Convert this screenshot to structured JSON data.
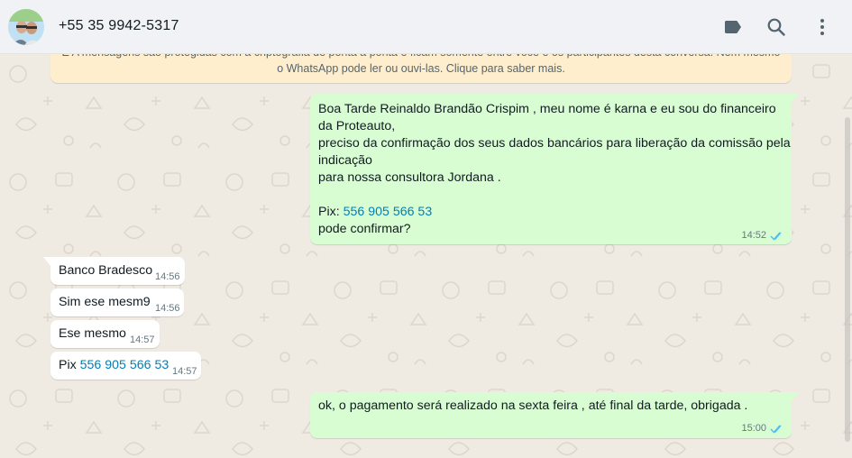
{
  "header": {
    "contact_name": "+55 35 9942-5317",
    "icons": [
      "label-icon",
      "search-icon",
      "menu-icon"
    ]
  },
  "encryption_notice": {
    "line1": "E A mensagens são protegidas com a criptografia de ponta a ponta e ficam somente entre você e os participantes desta conversa. Nem mesmo",
    "line2": "o WhatsApp pode ler ou ouvi-las. Clique para saber mais."
  },
  "messages": [
    {
      "direction": "outgoing",
      "lines": [
        "Boa Tarde Reinaldo Brandão Crispim , meu nome é karna  e eu sou do financeiro",
        "da Proteauto,",
        "preciso da confirmação dos seus dados bancários para liberação da comissão pela",
        "indicação",
        "para nossa consultora Jordana .",
        "",
        "Pix: ",
        "pode confirmar?"
      ],
      "link": "556 905 566 53",
      "time": "14:52",
      "status": "read"
    },
    {
      "direction": "incoming",
      "text": "Banco Bradesco",
      "time": "14:56"
    },
    {
      "direction": "incoming",
      "text": "Sim ese mesm9",
      "time": "14:56"
    },
    {
      "direction": "incoming",
      "text": "Ese mesmo",
      "time": "14:57"
    },
    {
      "direction": "incoming",
      "text": "Pix ",
      "link": "556 905 566 53",
      "time": "14:57"
    },
    {
      "direction": "outgoing",
      "text": "ok, o pagamento será realizado na sexta feira , até final da tarde, obrigada .",
      "time": "15:00",
      "status": "read"
    }
  ],
  "colors": {
    "chat_background": "#efeae2",
    "outgoing_bubble": "#d9fdd3",
    "incoming_bubble": "#ffffff",
    "notice_background": "#ffeecd",
    "link": "#027eb5",
    "read_ticks": "#53bdeb",
    "header_background": "#f0f2f5"
  }
}
